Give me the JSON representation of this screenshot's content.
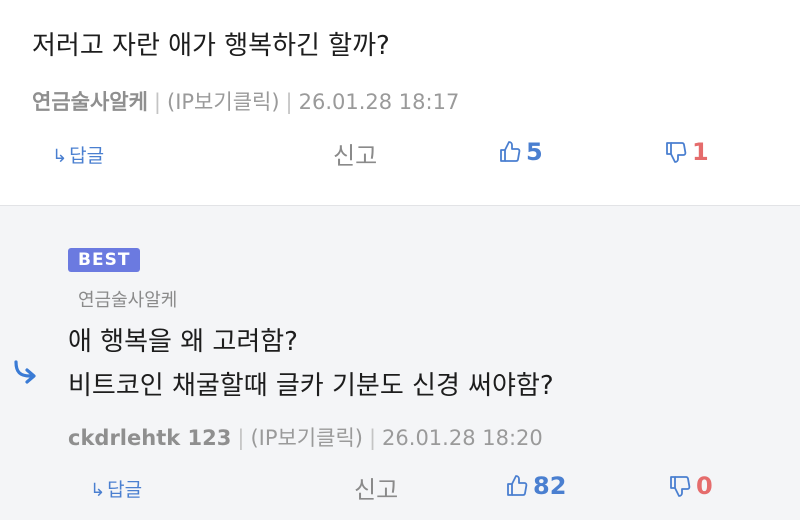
{
  "top_comment": {
    "content": "저러고 자란 애가 행복하긴 할까?",
    "author": "연금술사알케",
    "ip_label": "(IP보기클릭)",
    "timestamp": "26.01.28 18:17",
    "reply_label": "답글",
    "report_label": "신고",
    "upvotes": "5",
    "downvotes": "1"
  },
  "reply_comment": {
    "badge": "BEST",
    "quoted_author": "연금술사알케",
    "lines": [
      "애 행복을 왜 고려함?",
      "비트코인 채굴할때 글카 기분도 신경 써야함?"
    ],
    "author": "ckdrlehtk 123",
    "ip_label": "(IP보기클릭)",
    "timestamp": "26.01.28 18:20",
    "reply_label": "답글",
    "report_label": "신고",
    "upvotes": "82",
    "downvotes": "0"
  },
  "colors": {
    "upvote": "#4a7fd0",
    "downvote": "#e56c6c",
    "best_badge": "#6b7ae0",
    "reply_background": "#f4f5f7"
  }
}
